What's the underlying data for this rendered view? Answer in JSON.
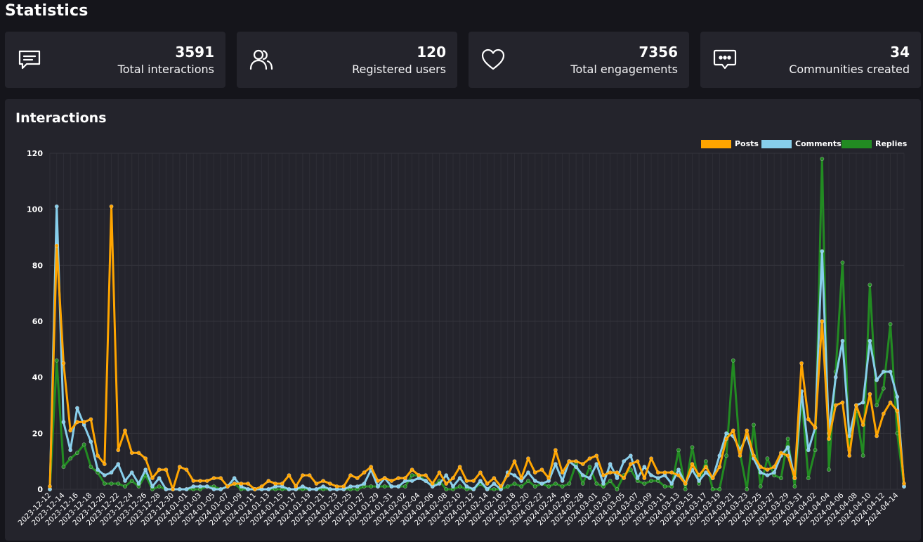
{
  "page": {
    "title": "Statistics"
  },
  "stats": [
    {
      "value": "3591",
      "label": "Total interactions",
      "icon": "message-square-icon"
    },
    {
      "value": "120",
      "label": "Registered users",
      "icon": "users-icon"
    },
    {
      "value": "7356",
      "label": "Total engagements",
      "icon": "heart-icon"
    },
    {
      "value": "34",
      "label": "Communities created",
      "icon": "message-dots-icon"
    }
  ],
  "panel": {
    "title": "Interactions"
  },
  "colors": {
    "background": "#15151b",
    "card": "#24242c",
    "posts": "#FFA500",
    "comments": "#87CEEB",
    "replies": "#228B22"
  },
  "chart_data": {
    "type": "line",
    "title": "",
    "xlabel": "",
    "ylabel": "",
    "ylim": [
      0,
      120
    ],
    "yticks": [
      0,
      20,
      40,
      60,
      80,
      100,
      120
    ],
    "grid": true,
    "legend_position": "top-right",
    "x": [
      "2023-12-12",
      "2023-12-13",
      "2023-12-14",
      "2023-12-15",
      "2023-12-16",
      "2023-12-17",
      "2023-12-18",
      "2023-12-19",
      "2023-12-20",
      "2023-12-21",
      "2023-12-22",
      "2023-12-23",
      "2023-12-24",
      "2023-12-25",
      "2023-12-26",
      "2023-12-27",
      "2023-12-28",
      "2023-12-29",
      "2023-12-30",
      "2023-12-31",
      "2024-01-01",
      "2024-01-02",
      "2024-01-03",
      "2024-01-04",
      "2024-01-05",
      "2024-01-06",
      "2024-01-07",
      "2024-01-08",
      "2024-01-09",
      "2024-01-10",
      "2024-01-11",
      "2024-01-12",
      "2024-01-13",
      "2024-01-14",
      "2024-01-15",
      "2024-01-16",
      "2024-01-17",
      "2024-01-18",
      "2024-01-19",
      "2024-01-20",
      "2024-01-21",
      "2024-01-22",
      "2024-01-23",
      "2024-01-24",
      "2024-01-25",
      "2024-01-26",
      "2024-01-27",
      "2024-01-28",
      "2024-01-29",
      "2024-01-30",
      "2024-01-31",
      "2024-02-01",
      "2024-02-02",
      "2024-02-03",
      "2024-02-04",
      "2024-02-05",
      "2024-02-06",
      "2024-02-07",
      "2024-02-08",
      "2024-02-09",
      "2024-02-10",
      "2024-02-11",
      "2024-02-12",
      "2024-02-13",
      "2024-02-14",
      "2024-02-15",
      "2024-02-16",
      "2024-02-17",
      "2024-02-18",
      "2024-02-19",
      "2024-02-20",
      "2024-02-21",
      "2024-02-22",
      "2024-02-23",
      "2024-02-24",
      "2024-02-25",
      "2024-02-26",
      "2024-02-27",
      "2024-02-28",
      "2024-02-29",
      "2024-03-01",
      "2024-03-02",
      "2024-03-03",
      "2024-03-04",
      "2024-03-05",
      "2024-03-06",
      "2024-03-07",
      "2024-03-08",
      "2024-03-09",
      "2024-03-10",
      "2024-03-11",
      "2024-03-12",
      "2024-03-13",
      "2024-03-14",
      "2024-03-15",
      "2024-03-16",
      "2024-03-17",
      "2024-03-18",
      "2024-03-19",
      "2024-03-20",
      "2024-03-21",
      "2024-03-22",
      "2024-03-23",
      "2024-03-24",
      "2024-03-25",
      "2024-03-26",
      "2024-03-27",
      "2024-03-28",
      "2024-03-29",
      "2024-03-30",
      "2024-03-31",
      "2024-04-01",
      "2024-04-02",
      "2024-04-03",
      "2024-04-04",
      "2024-04-05",
      "2024-04-06",
      "2024-04-07",
      "2024-04-08",
      "2024-04-09",
      "2024-04-10",
      "2024-04-11",
      "2024-04-12",
      "2024-04-13",
      "2024-04-14",
      "2024-04-15"
    ],
    "xtick_labels": [
      "2023-12-12",
      "2023-12-14",
      "2023-12-16",
      "2023-12-18",
      "2023-12-20",
      "2023-12-22",
      "2023-12-24",
      "2023-12-26",
      "2023-12-28",
      "2023-12-30",
      "2024-01-01",
      "2024-01-03",
      "2024-01-05",
      "2024-01-07",
      "2024-01-09",
      "2024-01-11",
      "2024-01-13",
      "2024-01-15",
      "2024-01-17",
      "2024-01-19",
      "2024-01-21",
      "2024-01-23",
      "2024-01-25",
      "2024-01-27",
      "2024-01-29",
      "2024-01-31",
      "2024-02-02",
      "2024-02-04",
      "2024-02-06",
      "2024-02-08",
      "2024-02-10",
      "2024-02-12",
      "2024-02-14",
      "2024-02-16",
      "2024-02-18",
      "2024-02-20",
      "2024-02-22",
      "2024-02-24",
      "2024-02-26",
      "2024-02-28",
      "2024-03-01",
      "2024-03-03",
      "2024-03-05",
      "2024-03-07",
      "2024-03-09",
      "2024-03-11",
      "2024-03-13",
      "2024-03-15",
      "2024-03-17",
      "2024-03-19",
      "2024-03-21",
      "2024-03-23",
      "2024-03-25",
      "2024-03-27",
      "2024-03-29",
      "2024-03-31",
      "2024-04-02",
      "2024-04-04",
      "2024-04-06",
      "2024-04-08",
      "2024-04-10",
      "2024-04-12",
      "2024-04-14"
    ],
    "series": [
      {
        "name": "Posts",
        "color": "#FFA500",
        "values": [
          1,
          87,
          45,
          21,
          24,
          24,
          25,
          12,
          9,
          101,
          14,
          21,
          13,
          13,
          11,
          4,
          7,
          7,
          0,
          8,
          7,
          3,
          3,
          3,
          4,
          4,
          1,
          2,
          2,
          2,
          0,
          1,
          3,
          2,
          2,
          5,
          1,
          5,
          5,
          2,
          3,
          2,
          1,
          1,
          5,
          4,
          6,
          8,
          3,
          4,
          3,
          4,
          4,
          7,
          5,
          5,
          2,
          6,
          2,
          4,
          8,
          3,
          3,
          6,
          2,
          4,
          1,
          5,
          10,
          4,
          11,
          6,
          7,
          4,
          14,
          6,
          10,
          10,
          9,
          11,
          12,
          5,
          6,
          6,
          4,
          9,
          10,
          4,
          11,
          6,
          6,
          6,
          5,
          2,
          9,
          5,
          8,
          4,
          8,
          18,
          21,
          12,
          21,
          12,
          8,
          7,
          8,
          13,
          12,
          4,
          45,
          25,
          22,
          60,
          18,
          30,
          31,
          12,
          30,
          23,
          34,
          19,
          27,
          31,
          28,
          2
        ]
      },
      {
        "name": "Comments",
        "color": "#87CEEB",
        "values": [
          0,
          101,
          24,
          14,
          29,
          23,
          17,
          7,
          5,
          6,
          9,
          3,
          6,
          2,
          7,
          1,
          4,
          0,
          0,
          0,
          0,
          1,
          1,
          1,
          0,
          0,
          1,
          4,
          1,
          0,
          0,
          0,
          0,
          1,
          1,
          0,
          0,
          1,
          0,
          0,
          1,
          0,
          0,
          0,
          1,
          1,
          2,
          7,
          1,
          4,
          1,
          1,
          3,
          3,
          4,
          3,
          1,
          2,
          5,
          1,
          4,
          1,
          0,
          3,
          0,
          2,
          0,
          6,
          5,
          3,
          6,
          3,
          2,
          3,
          9,
          3,
          10,
          8,
          5,
          4,
          9,
          2,
          9,
          4,
          10,
          12,
          4,
          8,
          5,
          4,
          5,
          2,
          7,
          2,
          7,
          3,
          6,
          4,
          12,
          20,
          19,
          14,
          19,
          11,
          6,
          5,
          6,
          12,
          15,
          4,
          35,
          14,
          22,
          85,
          20,
          40,
          53,
          19,
          30,
          31,
          53,
          39,
          42,
          42,
          33,
          1
        ]
      },
      {
        "name": "Replies",
        "color": "#228B22",
        "values": [
          0,
          46,
          8,
          11,
          13,
          16,
          8,
          6,
          2,
          2,
          2,
          1,
          3,
          1,
          5,
          0,
          1,
          0,
          0,
          0,
          0,
          0,
          0,
          1,
          1,
          0,
          1,
          2,
          0,
          0,
          0,
          0,
          0,
          0,
          0,
          0,
          0,
          0,
          0,
          0,
          0,
          0,
          0,
          0,
          0,
          0,
          1,
          1,
          1,
          1,
          1,
          1,
          1,
          5,
          5,
          3,
          1,
          3,
          0,
          0,
          1,
          0,
          0,
          2,
          0,
          0,
          0,
          1,
          2,
          1,
          3,
          1,
          2,
          1,
          2,
          1,
          2,
          9,
          2,
          8,
          2,
          1,
          3,
          0,
          5,
          7,
          3,
          2,
          3,
          3,
          1,
          1,
          14,
          0,
          15,
          2,
          10,
          0,
          0,
          12,
          46,
          13,
          0,
          23,
          1,
          11,
          5,
          4,
          18,
          1,
          33,
          4,
          14,
          118,
          7,
          42,
          81,
          14,
          28,
          12,
          73,
          30,
          36,
          59,
          20,
          1
        ]
      }
    ]
  }
}
